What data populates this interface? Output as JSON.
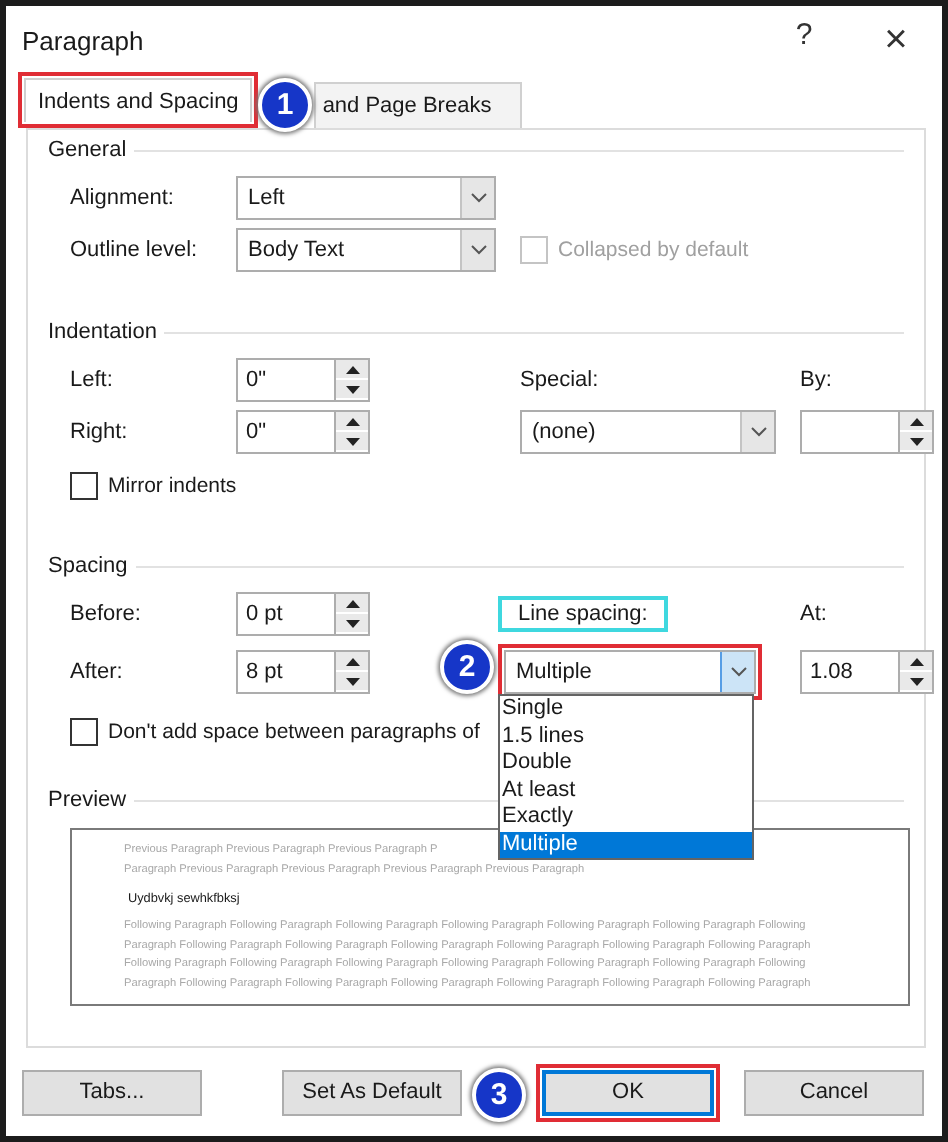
{
  "window": {
    "title": "Paragraph",
    "help": "?",
    "close": "×"
  },
  "tabs": [
    {
      "label": "Indents and Spacing",
      "selected": true,
      "highlighted": true
    },
    {
      "label": "and Page Breaks",
      "selected": false
    }
  ],
  "tab_badge": "1",
  "general": {
    "heading": "General",
    "alignment": {
      "label": "Alignment:",
      "value": "Left"
    },
    "outline_level": {
      "label": "Outline level:",
      "value": "Body Text"
    },
    "collapsed": {
      "label": "Collapsed by default",
      "checked": false,
      "disabled": true
    }
  },
  "indentation": {
    "heading": "Indentation",
    "left": {
      "label": "Left:",
      "value": "0\""
    },
    "right": {
      "label": "Right:",
      "value": "0\""
    },
    "special": {
      "label": "Special:",
      "value": "(none)"
    },
    "by": {
      "label": "By:"
    },
    "mirror": {
      "label": "Mirror indents",
      "checked": false
    }
  },
  "spacing": {
    "heading": "Spacing",
    "before": {
      "label": "Before:",
      "value": "0 pt"
    },
    "after": {
      "label": "After:",
      "value": "8 pt"
    },
    "line_spacing": {
      "label": "Line spacing:",
      "label_highlighted": true,
      "value": "Multiple",
      "highlighted": true,
      "badge": "2",
      "expanded": true,
      "options": [
        {
          "label": "Single",
          "selected": false
        },
        {
          "label": "1.5 lines",
          "selected": false
        },
        {
          "label": "Double",
          "selected": false
        },
        {
          "label": "At least",
          "selected": false
        },
        {
          "label": "Exactly",
          "selected": false
        },
        {
          "label": "Multiple",
          "selected": true
        }
      ]
    },
    "at": {
      "label": "At:",
      "value": "1.08"
    },
    "dont_add": {
      "label": "Don't add space between paragraphs of",
      "checked": false
    }
  },
  "preview": {
    "heading": "Preview",
    "previous_lines": [
      "Previous Paragraph Previous Paragraph Previous Paragraph P",
      "Paragraph Previous Paragraph Previous Paragraph Previous Paragraph Previous Paragraph"
    ],
    "sample": "Uydbvkj sewhkfbksj",
    "following_lines": [
      "Following Paragraph Following Paragraph Following Paragraph Following Paragraph Following Paragraph Following Paragraph Following",
      "Paragraph Following Paragraph Following Paragraph Following Paragraph Following Paragraph Following Paragraph Following Paragraph",
      "Following Paragraph Following Paragraph Following Paragraph Following Paragraph Following Paragraph Following Paragraph Following",
      "Paragraph Following Paragraph Following Paragraph Following Paragraph Following Paragraph Following Paragraph Following Paragraph"
    ]
  },
  "buttons": [
    {
      "label": "Tabs...",
      "default": false
    },
    {
      "label": "Set As Default",
      "default": false
    },
    {
      "label": "OK",
      "default": true,
      "highlighted": true,
      "badge": "3"
    },
    {
      "label": "Cancel",
      "default": false
    }
  ]
}
